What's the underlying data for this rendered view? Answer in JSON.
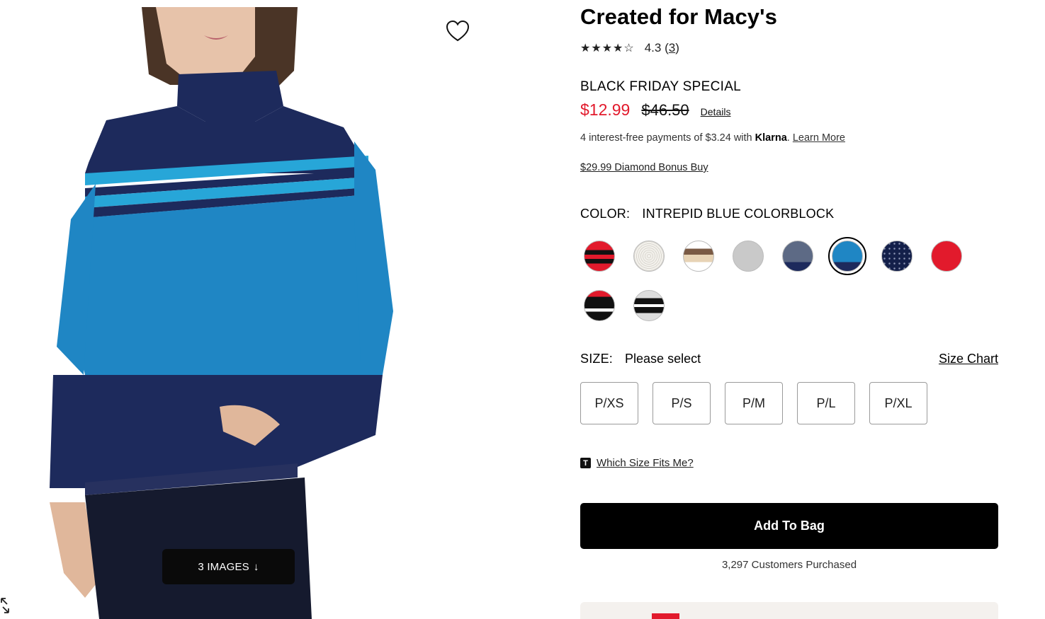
{
  "gallery": {
    "images_button_label": "3 IMAGES",
    "images_button_arrow": "↓"
  },
  "product": {
    "title": "Created for Macy's",
    "stars": "★★★★☆",
    "rating": "4.3",
    "review_count": "3",
    "promo_label": "BLACK FRIDAY SPECIAL",
    "sale_price": "$12.99",
    "original_price": "$46.50",
    "details_link": "Details",
    "klarna_prefix": "4 interest-free payments of $3.24 with ",
    "klarna_brand": "Klarna",
    "klarna_link": "Learn More",
    "bonus_link": "$29.99 Diamond Bonus Buy"
  },
  "color": {
    "label": "COLOR:",
    "selected": "INTREPID BLUE COLORBLOCK",
    "swatch_icons": [
      "red-black-stripe-swatch",
      "white-pattern-swatch",
      "brown-tan-swatch",
      "grey-pattern-swatch",
      "navy-grey-swatch",
      "intrepid-blue-swatch",
      "navy-dot-swatch",
      "red-knit-swatch",
      "black-red-white-swatch",
      "black-white-stripe-swatch"
    ]
  },
  "size": {
    "label": "SIZE:",
    "value": "Please select",
    "chart_link": "Size Chart",
    "options": [
      "P/XS",
      "P/S",
      "P/M",
      "P/L",
      "P/XL"
    ]
  },
  "fit": {
    "badge": "T",
    "link": "Which Size Fits Me?"
  },
  "cart": {
    "add_label": "Add To Bag",
    "purchased": "3,297 Customers Purchased"
  },
  "colors": {
    "sale_red": "#e21a2c",
    "navy": "#1d2a5c",
    "intrepid_blue": "#1f86c4",
    "stripe_blue": "#27a6d8"
  }
}
